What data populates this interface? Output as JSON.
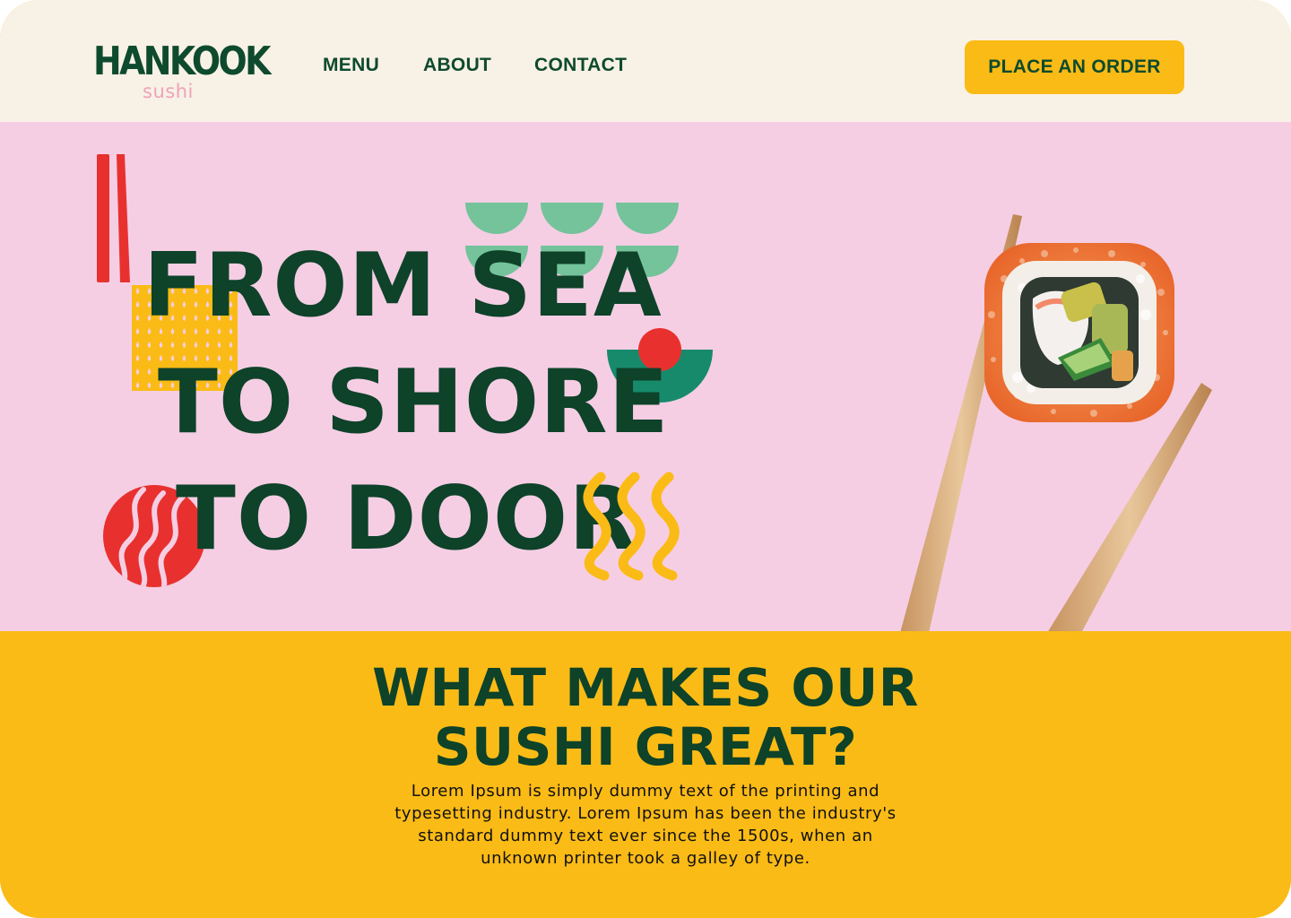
{
  "header": {
    "logo_main": "HANKOOK",
    "logo_sub": "sushi",
    "nav": {
      "menu": "MENU",
      "about": "ABOUT",
      "contact": "CONTACT"
    },
    "cta_label": "PLACE AN ORDER"
  },
  "hero": {
    "lines": [
      "FROM SEA",
      "TO SHORE",
      "TO DOOR"
    ]
  },
  "features": {
    "title_line1": "WHAT MAKES OUR",
    "title_line2": "SUSHI GREAT?",
    "body": "Lorem Ipsum is simply dummy text of the printing and typesetting industry. Lorem Ipsum has been the industry's standard dummy text ever since the 1500s, when an unknown printer took a galley of type."
  },
  "colors": {
    "header_bg": "#f8f1e6",
    "hero_bg": "#f5cee4",
    "accent_yellow": "#fbbb16",
    "brand_green": "#0e4a2d",
    "logo_pink": "#efa3b8",
    "deco_red": "#e8312f",
    "deco_mint": "#74c39b",
    "deco_teal": "#178a6c"
  },
  "icons": [
    "chopsticks-decoration",
    "dotted-square-decoration",
    "scallop-wave-decoration",
    "sun-bowl-decoration",
    "wavy-circle-decoration",
    "squiggle-lines-decoration",
    "sushi-chopsticks-illustration"
  ]
}
